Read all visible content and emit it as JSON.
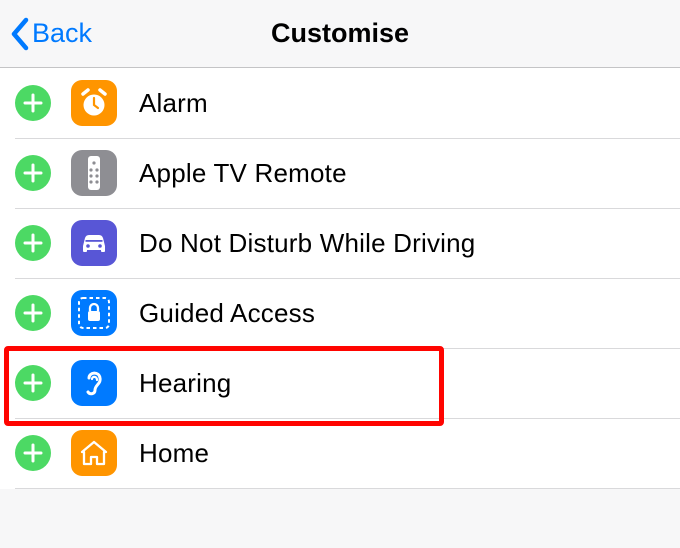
{
  "nav": {
    "back_label": "Back",
    "title": "Customise"
  },
  "rows": [
    {
      "id": "alarm",
      "label": "Alarm"
    },
    {
      "id": "apple-tv-remote",
      "label": "Apple TV Remote"
    },
    {
      "id": "dnd-driving",
      "label": "Do Not Disturb While Driving"
    },
    {
      "id": "guided-access",
      "label": "Guided Access"
    },
    {
      "id": "hearing",
      "label": "Hearing"
    },
    {
      "id": "home",
      "label": "Home"
    }
  ],
  "highlighted_row_index": 4
}
